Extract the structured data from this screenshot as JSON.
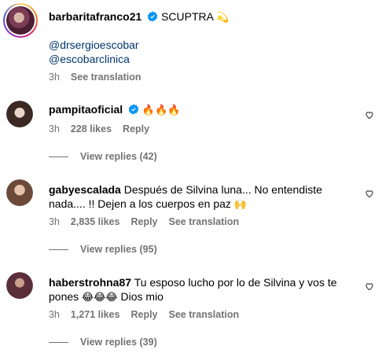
{
  "post": {
    "username": "barbaritafranco21",
    "caption": "SCUPTRA",
    "caption_emoji": "💫",
    "mentions": [
      "@drsergioescobar",
      "@escobarclinica"
    ],
    "time": "3h",
    "see_translation": "See translation"
  },
  "comments": [
    {
      "username": "pampitaoficial",
      "verified": true,
      "text": "",
      "emoji": "🔥🔥🔥",
      "time": "3h",
      "likes": "228 likes",
      "reply": "Reply",
      "view_replies": "View replies (42)"
    },
    {
      "username": "gabyescalada",
      "text_line1": "Después de Silvina luna... No entendiste",
      "text_line2": "nada.... !! Dejen a los cuerpos en paz",
      "emoji": "🙌",
      "time": "3h",
      "likes": "2,835 likes",
      "reply": "Reply",
      "see_translation": "See translation",
      "view_replies": "View replies (95)"
    },
    {
      "username": "haberstrohna87",
      "text_line1": "Tu esposo lucho por lo de Silvina y vos te",
      "text_line2_pre": "pones",
      "emoji": "😂😂😂",
      "text_line2_post": "Dios mio",
      "time": "3h",
      "likes": "1,271 likes",
      "reply": "Reply",
      "see_translation": "See translation",
      "view_replies": "View replies (39)"
    }
  ]
}
